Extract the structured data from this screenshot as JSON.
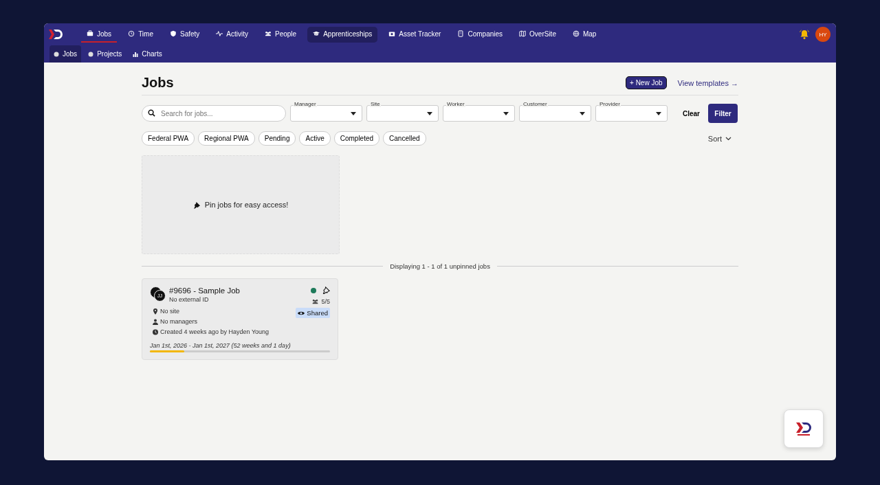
{
  "nav": {
    "tabs": [
      {
        "label": "Jobs",
        "selected": true,
        "highlighted": false
      },
      {
        "label": "Time",
        "selected": false,
        "highlighted": false
      },
      {
        "label": "Safety",
        "selected": false,
        "highlighted": false
      },
      {
        "label": "Activity",
        "selected": false,
        "highlighted": false
      },
      {
        "label": "People",
        "selected": false,
        "highlighted": false
      },
      {
        "label": "Apprenticeships",
        "selected": false,
        "highlighted": true
      },
      {
        "label": "Asset Tracker",
        "selected": false,
        "highlighted": false
      },
      {
        "label": "Companies",
        "selected": false,
        "highlighted": false
      },
      {
        "label": "OverSite",
        "selected": false,
        "highlighted": false
      },
      {
        "label": "Map",
        "selected": false,
        "highlighted": false
      }
    ],
    "user_initials": "HY"
  },
  "subnav": {
    "tabs": [
      {
        "label": "Jobs",
        "selected": true
      },
      {
        "label": "Projects",
        "selected": false
      },
      {
        "label": "Charts",
        "selected": false
      }
    ]
  },
  "page": {
    "title": "Jobs",
    "new_button": "+ New Job",
    "templates_link": "View templates →"
  },
  "filters": {
    "search_placeholder": "Search for jobs...",
    "dropdowns": [
      {
        "label": "Manager"
      },
      {
        "label": "Site"
      },
      {
        "label": "Worker"
      },
      {
        "label": "Customer"
      },
      {
        "label": "Provider"
      }
    ],
    "clear": "Clear",
    "filter": "Filter",
    "chips": [
      {
        "label": "Federal PWA",
        "selected": false
      },
      {
        "label": "Regional PWA",
        "selected": false
      },
      {
        "label": "Pending",
        "selected": false
      },
      {
        "label": "Active",
        "selected": false
      },
      {
        "label": "Completed",
        "selected": false
      },
      {
        "label": "Cancelled",
        "selected": false
      }
    ],
    "sort": "Sort"
  },
  "pinned_placeholder": "Pin jobs for easy access!",
  "divider_text": "Displaying 1 - 1 of 1 unpinned jobs",
  "jobs": [
    {
      "avatar": "JJ",
      "title": "#9696 - Sample Job",
      "external_id": "No external ID",
      "pinned": false,
      "workers": "5/5",
      "shared": "Shared",
      "site": "No site",
      "managers": "No managers",
      "created": "Created 4 weeks ago by Hayden Young",
      "dates": "Jan 1st, 2026 - Jan 1st, 2027 (52 weeks and 1 day)",
      "level": 0.19
    }
  ]
}
